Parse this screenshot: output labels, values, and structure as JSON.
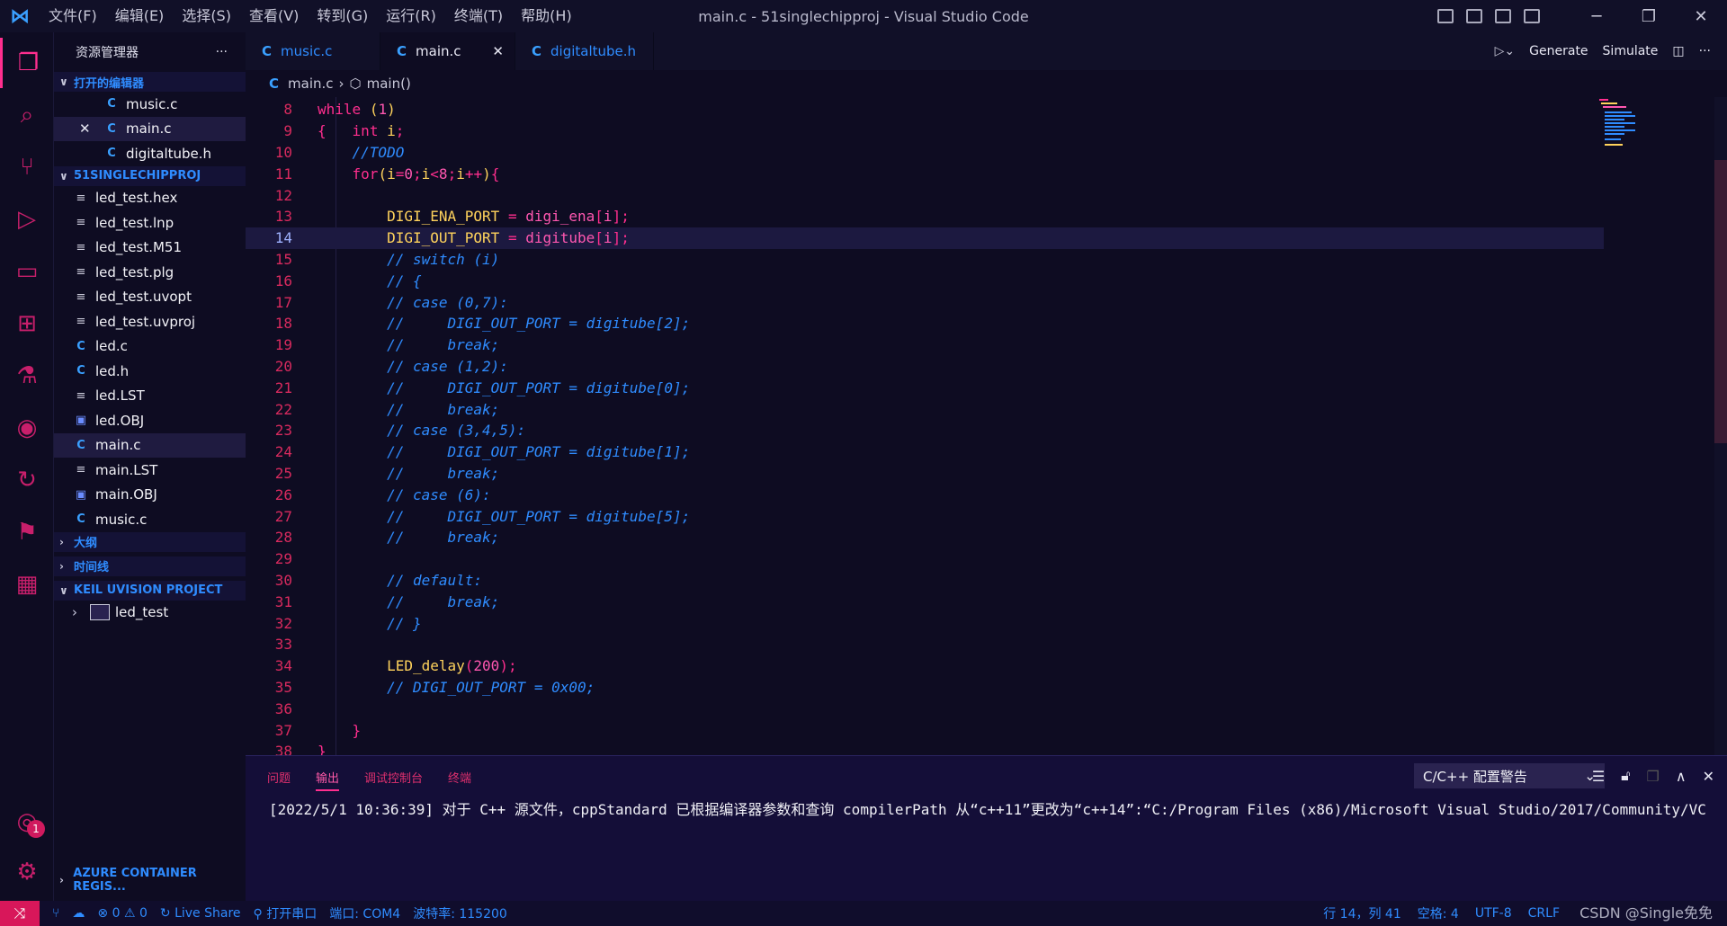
{
  "titlebar": {
    "menus": [
      "文件(F)",
      "编辑(E)",
      "选择(S)",
      "查看(V)",
      "转到(G)",
      "运行(R)",
      "终端(T)",
      "帮助(H)"
    ],
    "window_title": "main.c - 51singlechipproj - Visual Studio Code"
  },
  "activity": {
    "account_badge": "1"
  },
  "sidebar": {
    "title": "资源管理器",
    "open_editors_label": "打开的编辑器",
    "open_editors": [
      {
        "icon": "C",
        "name": "music.c"
      },
      {
        "icon": "C",
        "name": "main.c"
      },
      {
        "icon": "C",
        "name": "digitaltube.h"
      }
    ],
    "project_label": "51SINGLECHIPPROJ",
    "files": [
      {
        "icon": "≡",
        "name": "led_test.hex"
      },
      {
        "icon": "≡",
        "name": "led_test.lnp"
      },
      {
        "icon": "≡",
        "name": "led_test.M51"
      },
      {
        "icon": "≡",
        "name": "led_test.plg"
      },
      {
        "icon": "≡",
        "name": "led_test.uvopt"
      },
      {
        "icon": "≡",
        "name": "led_test.uvproj"
      },
      {
        "icon": "C",
        "name": "led.c"
      },
      {
        "icon": "C",
        "name": "led.h"
      },
      {
        "icon": "≡",
        "name": "led.LST"
      },
      {
        "icon": "▣",
        "name": "led.OBJ"
      },
      {
        "icon": "C",
        "name": "main.c"
      },
      {
        "icon": "≡",
        "name": "main.LST"
      },
      {
        "icon": "▣",
        "name": "main.OBJ"
      },
      {
        "icon": "C",
        "name": "music.c"
      }
    ],
    "outline_label": "大纲",
    "timeline_label": "时间线",
    "keil_label": "KEIL UVISION PROJECT",
    "keil_item": "led_test",
    "azure_label": "AZURE CONTAINER REGIS..."
  },
  "tabs": [
    {
      "icon": "C",
      "name": "music.c"
    },
    {
      "icon": "C",
      "name": "main.c"
    },
    {
      "icon": "C",
      "name": "digitaltube.h"
    }
  ],
  "toolbar": {
    "generate": "Generate",
    "simulate": "Simulate"
  },
  "breadcrumb": {
    "file": "main.c",
    "symbol": "main()"
  },
  "editor": {
    "current_line": 14
  },
  "panel": {
    "tabs": [
      "问题",
      "输出",
      "调试控制台",
      "终端"
    ],
    "select": "C/C++ 配置警告",
    "output": "[2022/5/1 10:36:39] 对于 C++ 源文件，cppStandard 已根据编译器参数和查询 compilerPath 从“c++11”更改为“c++14”:“C:/Program Files (x86)/Microsoft Visual Studio/2017/Community/VC"
  },
  "status": {
    "errors": "0",
    "warnings": "0",
    "live_share": "Live Share",
    "serial": "打开串口",
    "port": "端口: COM4",
    "baud": "波特率: 115200",
    "position": "行 14，列 41",
    "spaces": "空格: 4",
    "encoding": "UTF-8",
    "eol": "CRLF",
    "watermark": "CSDN @Single免免"
  },
  "colors": {
    "accent": "#ff2e8e",
    "keyword": "#ff2e8e",
    "comment": "#2f8cff",
    "identifier": "#ffd35c",
    "background": "#0e0c22"
  }
}
